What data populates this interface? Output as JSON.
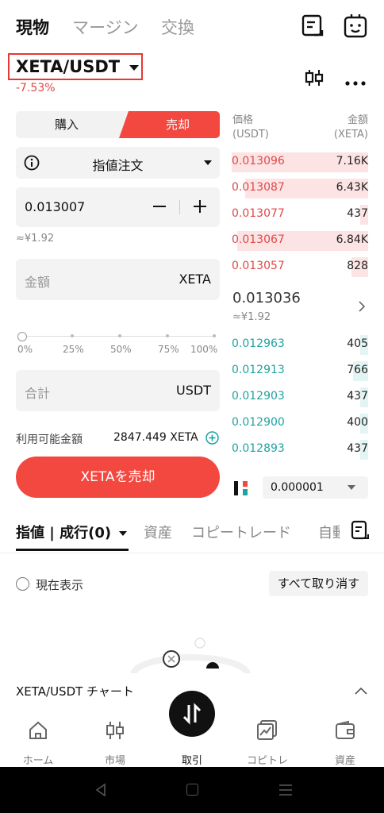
{
  "top_tabs": [
    "現物",
    "マージン",
    "交換"
  ],
  "pair": {
    "name": "XETA/USDT",
    "change": "-7.53%"
  },
  "trade": {
    "buy_label": "購入",
    "sell_label": "売却",
    "order_type": "指値注文",
    "price_value": "0.013007",
    "price_approx": "≈¥1.92",
    "amount_placeholder": "金額",
    "amount_unit": "XETA",
    "slider_ticks": [
      "0%",
      "25%",
      "50%",
      "75%",
      "100%"
    ],
    "slider_level": 0,
    "total_placeholder": "合計",
    "total_unit": "USDT",
    "available_label": "利用可能金額",
    "available_value": "2847.449 XETA",
    "submit_label": "XETAを売却"
  },
  "order_book": {
    "price_header": "価格",
    "price_header_unit": "(USDT)",
    "amount_header": "金額",
    "amount_header_unit": "(XETA)",
    "asks": [
      {
        "price": "0.013096",
        "qty": "7.16K",
        "depth": 1.0
      },
      {
        "price": "0.013087",
        "qty": "6.43K",
        "depth": 0.9
      },
      {
        "price": "0.013077",
        "qty": "437",
        "depth": 0.06
      },
      {
        "price": "0.013067",
        "qty": "6.84K",
        "depth": 0.96
      },
      {
        "price": "0.013057",
        "qty": "828",
        "depth": 0.12
      }
    ],
    "last_price": "0.013036",
    "last_price_approx": "≈¥1.92",
    "bids": [
      {
        "price": "0.012963",
        "qty": "405",
        "depth": 0.06
      },
      {
        "price": "0.012913",
        "qty": "766",
        "depth": 0.11
      },
      {
        "price": "0.012903",
        "qty": "437",
        "depth": 0.06
      },
      {
        "price": "0.012900",
        "qty": "400",
        "depth": 0.06
      },
      {
        "price": "0.012893",
        "qty": "437",
        "depth": 0.06
      }
    ],
    "precision": "0.000001"
  },
  "sub_tabs": {
    "orders": "指値 | 成行(0)",
    "assets": "資産",
    "copy_trade": "コピートレード",
    "cut": "自動"
  },
  "filter": {
    "current_label": "現在表示",
    "cancel_all": "すべて取り消す"
  },
  "chart_bar": {
    "label": "XETA/USDT チャート"
  },
  "bottom_nav": [
    "ホーム",
    "市場",
    "取引",
    "コピトレ",
    "資産"
  ],
  "colors": {
    "sell": "#f2483f",
    "ask": "#e04848",
    "bid": "#1fa3a0"
  }
}
